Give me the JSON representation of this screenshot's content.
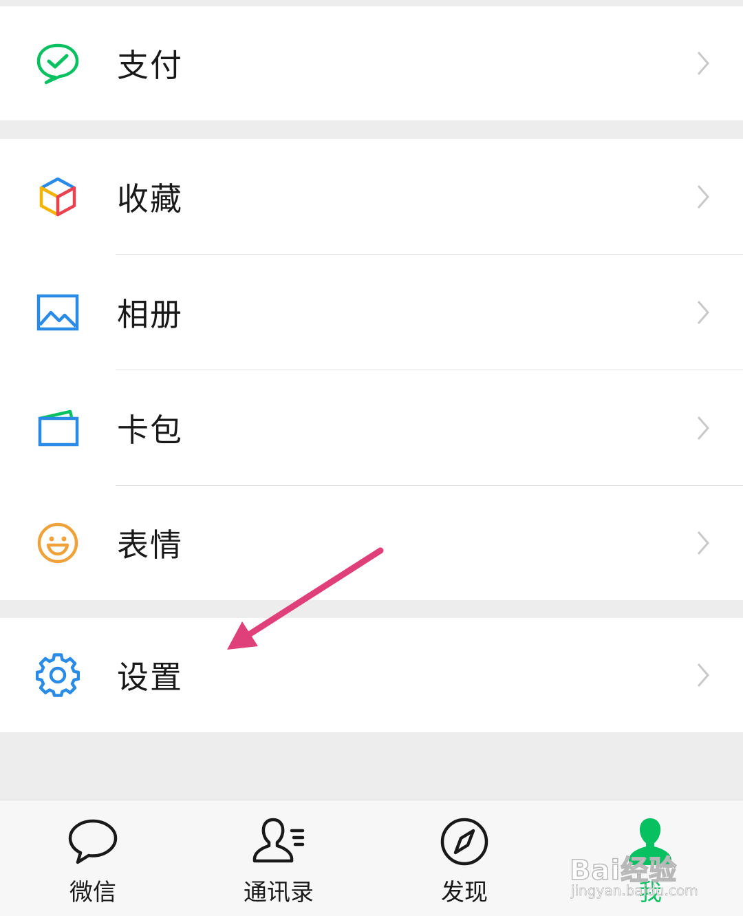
{
  "menu": {
    "pay": {
      "label": "支付",
      "icon": "wechat-pay-icon"
    },
    "favorites": {
      "label": "收藏",
      "icon": "favorites-cube-icon"
    },
    "album": {
      "label": "相册",
      "icon": "album-picture-icon"
    },
    "cards": {
      "label": "卡包",
      "icon": "card-wallet-icon"
    },
    "stickers": {
      "label": "表情",
      "icon": "smiley-icon"
    },
    "settings": {
      "label": "设置",
      "icon": "gear-icon"
    }
  },
  "tabbar": {
    "tabs": [
      {
        "label": "微信",
        "icon": "chat-bubble-icon",
        "active": false
      },
      {
        "label": "通讯录",
        "icon": "contacts-icon",
        "active": false
      },
      {
        "label": "发现",
        "icon": "compass-icon",
        "active": false
      },
      {
        "label": "我",
        "icon": "person-icon",
        "active": true
      }
    ]
  },
  "annotation": {
    "icon": "pointing-arrow",
    "color": "#e0407a"
  },
  "watermark": {
    "main": "Bai经验",
    "sub": "jingyan.baidu.com"
  },
  "colors": {
    "accent": "#07c160",
    "background": "#ededed",
    "icon_blue": "#2a8be6",
    "icon_orange": "#f0a23a"
  }
}
